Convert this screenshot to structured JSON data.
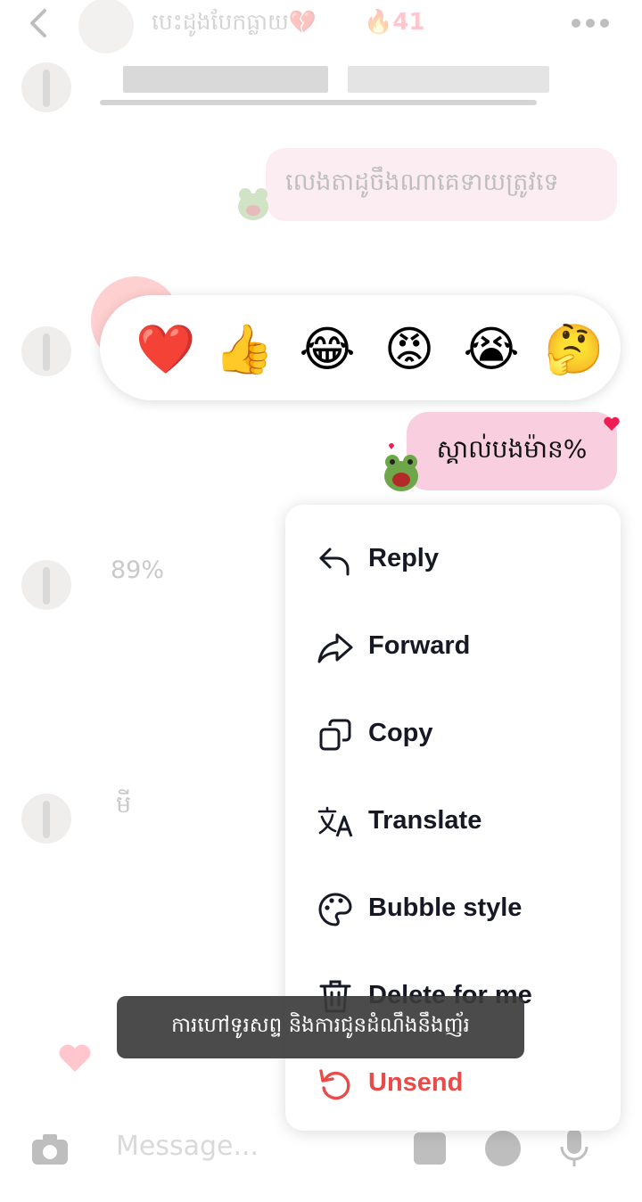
{
  "header": {
    "title": "បេះដូងបែកធ្លាយ💔",
    "streak_icon": "🔥",
    "streak_count": "41"
  },
  "chat": {
    "outgoing_message_1": "លេងតាដូចឹងណាគេទាយត្រូវទេ",
    "selected_message": "ស្គាល់បងម៉ាន%",
    "incoming_message_1": "89%",
    "incoming_message_2": "មី"
  },
  "reactions": [
    "❤️",
    "👍",
    "😂",
    "😡",
    "😭",
    "🤔"
  ],
  "context_menu": {
    "items": [
      {
        "label": "Reply",
        "icon": "reply-icon"
      },
      {
        "label": "Forward",
        "icon": "forward-icon"
      },
      {
        "label": "Copy",
        "icon": "copy-icon"
      },
      {
        "label": "Translate",
        "icon": "translate-icon"
      },
      {
        "label": "Bubble style",
        "icon": "palette-icon"
      },
      {
        "label": "Delete for me",
        "icon": "trash-icon"
      },
      {
        "label": "Unsend",
        "icon": "undo-icon"
      }
    ]
  },
  "toast": {
    "text": "ការហៅទូរសព្ទ និងការជូនដំណឹងនឹងញ័រ"
  },
  "composer": {
    "placeholder": "Message..."
  },
  "colors": {
    "accent_pink": "#f9cfe0",
    "danger": "#ea4a48",
    "text_dark": "#161823"
  }
}
